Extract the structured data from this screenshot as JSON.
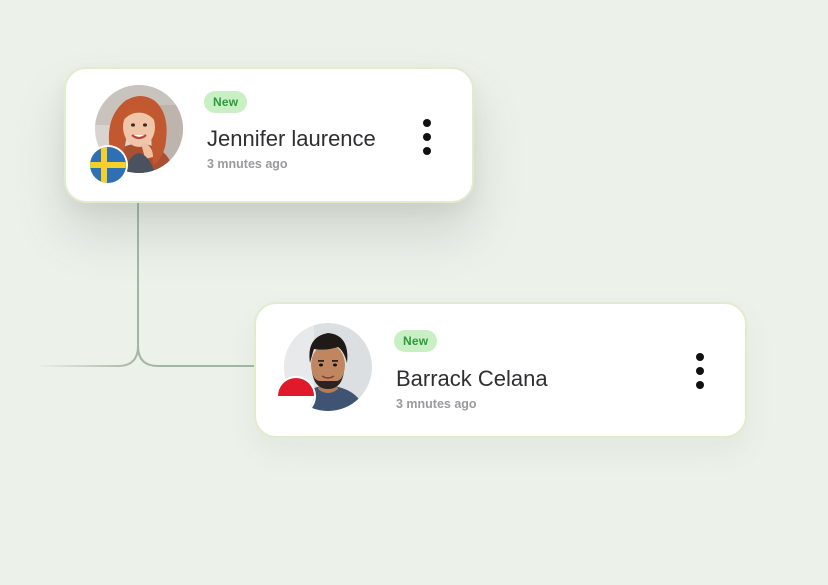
{
  "cards": [
    {
      "badge": "New",
      "name": "Jennifer laurence",
      "time": "3 mnutes ago",
      "flag": "sweden",
      "avatar": "woman-portrait"
    },
    {
      "badge": "New",
      "name": "Barrack Celana",
      "time": "3 mnutes ago",
      "flag": "indonesia",
      "avatar": "man-portrait"
    }
  ],
  "colors": {
    "background": "#ecf1ea",
    "card_border": "#dfeccd",
    "badge_bg": "#c9f0c4",
    "badge_text": "#2c9a3a",
    "connector": "#a3b6a3",
    "name_text": "#2f2f33",
    "time_text": "#9a9a9e"
  },
  "icons": {
    "menu": "more-vertical-icon"
  }
}
